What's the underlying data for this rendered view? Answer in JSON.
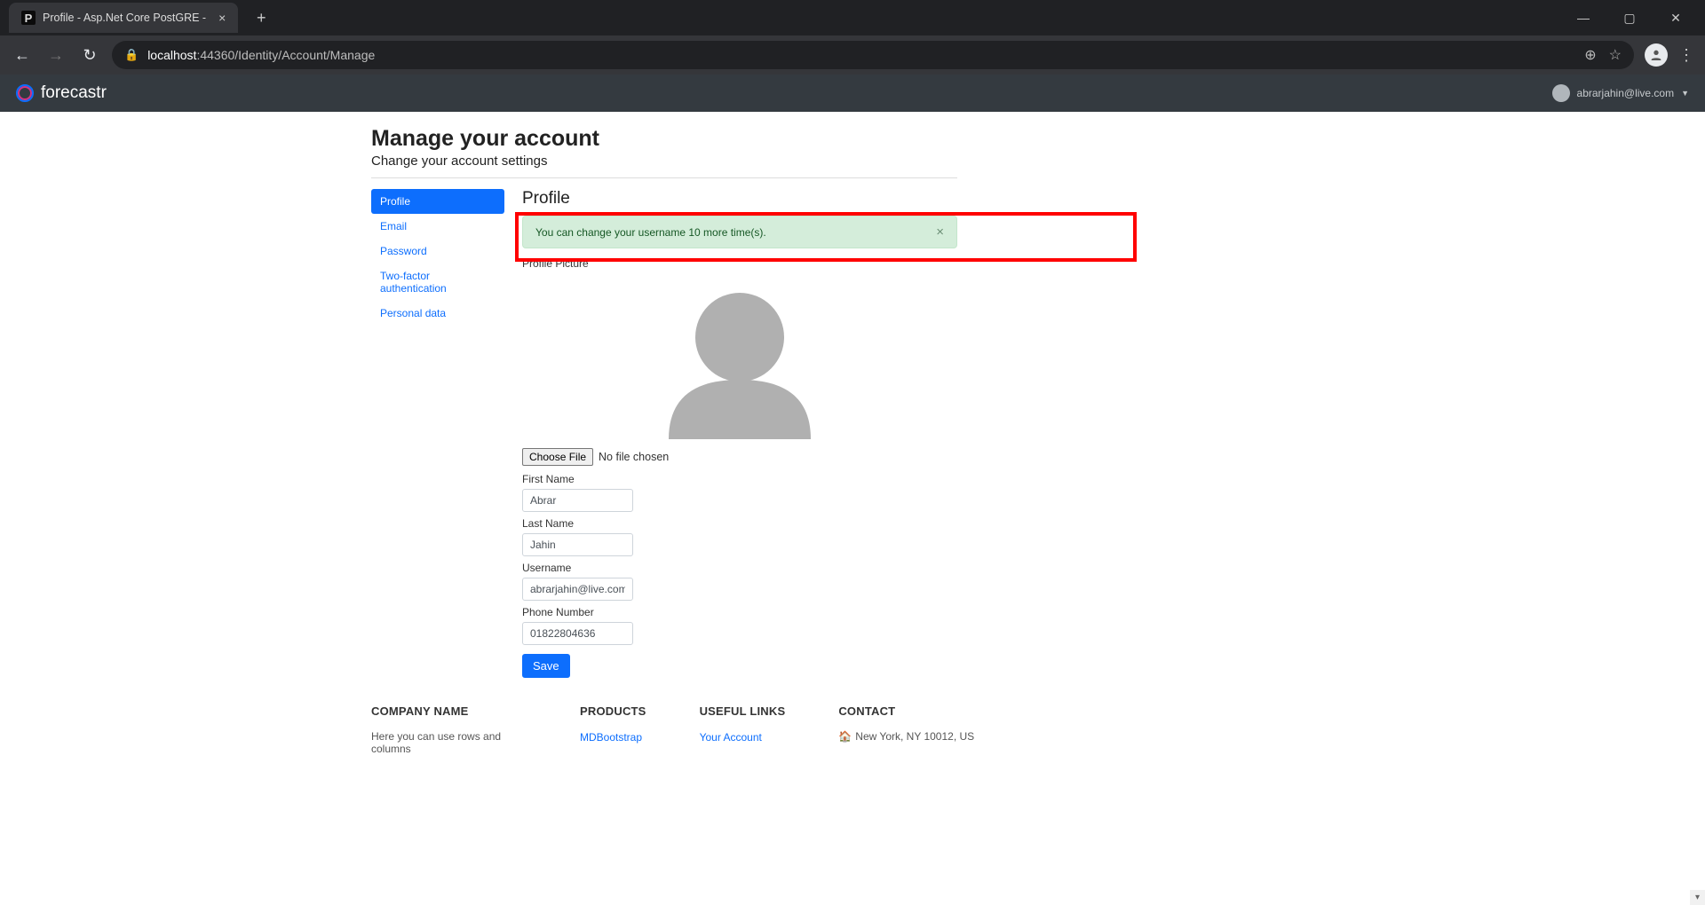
{
  "browser": {
    "tab_title": "Profile - Asp.Net Core PostGRE - ",
    "tab_favicon": "P",
    "url_host": "localhost",
    "url_port": ":44360",
    "url_path": "/Identity/Account/Manage"
  },
  "navbar": {
    "brand": "forecastr",
    "user_email": "abrarjahin@live.com"
  },
  "page": {
    "title": "Manage your account",
    "subtitle": "Change your account settings"
  },
  "sidebar": {
    "items": [
      {
        "label": "Profile",
        "active": true
      },
      {
        "label": "Email",
        "active": false
      },
      {
        "label": "Password",
        "active": false
      },
      {
        "label": "Two-factor authentication",
        "active": false
      },
      {
        "label": "Personal data",
        "active": false
      }
    ]
  },
  "profile": {
    "section_title": "Profile",
    "alert_text": "You can change your username 10 more time(s).",
    "pic_label": "Profile Picture",
    "choose_file_label": "Choose File",
    "file_status": "No file chosen",
    "first_name_label": "First Name",
    "first_name_value": "Abrar",
    "last_name_label": "Last Name",
    "last_name_value": "Jahin",
    "username_label": "Username",
    "username_value": "abrarjahin@live.com",
    "phone_label": "Phone Number",
    "phone_value": "01822804636",
    "save_label": "Save"
  },
  "footer": {
    "company_title": "COMPANY NAME",
    "company_desc": "Here you can use rows and columns",
    "products_title": "PRODUCTS",
    "product_link": "MDBootstrap",
    "links_title": "USEFUL LINKS",
    "link_1": "Your Account",
    "contact_title": "CONTACT",
    "contact_address": "New York, NY 10012, US"
  }
}
